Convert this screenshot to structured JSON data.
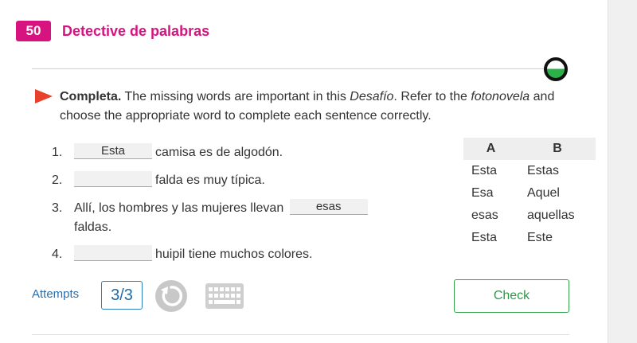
{
  "header": {
    "number": "50",
    "title": "Detective de palabras"
  },
  "instructions": {
    "lead": "Completa.",
    "part1": " The missing words are important in this ",
    "em1": "Desafío",
    "part2": ". Refer to the ",
    "em2": "fotonovela",
    "part3": " and choose the appropriate word to complete each sentence correctly."
  },
  "items": [
    {
      "num": "1.",
      "answer": "Esta",
      "text": "camisa es de algodón."
    },
    {
      "num": "2.",
      "answer": "",
      "text": "falda es muy típica."
    },
    {
      "num": "3.",
      "before": "Allí, los hombres y las mujeres llevan",
      "answer": "esas",
      "after": "faldas."
    },
    {
      "num": "4.",
      "answer": "",
      "text": "huipil tiene muchos colores."
    }
  ],
  "word_table": {
    "headers": [
      "A",
      "B"
    ],
    "rows": [
      [
        "Esta",
        "Estas"
      ],
      [
        "Esa",
        "Aquel"
      ],
      [
        "esas",
        "aquellas"
      ],
      [
        "Esta",
        "Este"
      ]
    ]
  },
  "footer": {
    "attempts_label": "Attempts",
    "attempts_value": "3/3",
    "check_label": "Check"
  },
  "colors": {
    "accent": "#d6137f",
    "arrow": "#e8402a",
    "check_green": "#2b9a47",
    "link_blue": "#2a6fb0"
  },
  "progress": {
    "fraction_complete": 0.5
  }
}
